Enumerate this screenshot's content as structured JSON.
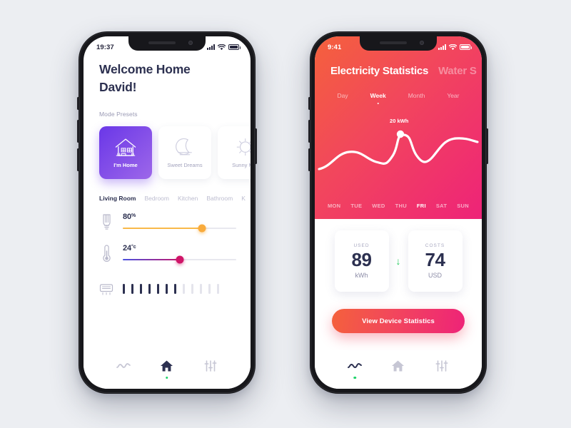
{
  "left_phone": {
    "status_bar": {
      "time": "19:37",
      "signal_icon": "signal-bars-icon",
      "wifi_icon": "wifi-icon",
      "battery_icon": "battery-icon"
    },
    "greeting_line1": "Welcome Home",
    "greeting_line2": "David!",
    "section_label": "Mode Presets",
    "presets": [
      {
        "label": "I'm Home",
        "icon": "house-icon",
        "active": true
      },
      {
        "label": "Sweet Dreams",
        "icon": "moon-icon",
        "active": false
      },
      {
        "label": "Sunny Mo",
        "icon": "sun-icon",
        "active": false
      }
    ],
    "rooms": [
      {
        "label": "Living Room",
        "active": true
      },
      {
        "label": "Bedroom",
        "active": false
      },
      {
        "label": "Kitchen",
        "active": false
      },
      {
        "label": "Bathroom",
        "active": false
      },
      {
        "label": "K",
        "active": false
      }
    ],
    "controls": {
      "light": {
        "icon": "lightbulb-icon",
        "value": "80",
        "unit": "%",
        "percent": 70,
        "fill_color": "#f9b949",
        "knob_color": "#f9ab3c"
      },
      "temperature": {
        "icon": "thermometer-icon",
        "value": "24",
        "unit": "°c",
        "percent": 50,
        "knob_color": "#cf1568"
      },
      "ac": {
        "icon": "air-conditioner-icon",
        "total_bars": 12,
        "active_bars": 7
      }
    },
    "nav": [
      {
        "icon": "stats-wave-icon",
        "active": false
      },
      {
        "icon": "home-icon",
        "active": true
      },
      {
        "icon": "sliders-icon",
        "active": false
      }
    ]
  },
  "right_phone": {
    "status_bar": {
      "time": "9:41",
      "signal_icon": "signal-bars-icon",
      "wifi_icon": "wifi-icon",
      "battery_icon": "battery-icon"
    },
    "title_active": "Electricity Statistics",
    "title_next": "Water S",
    "range_tabs": [
      {
        "label": "Day",
        "active": false
      },
      {
        "label": "Week",
        "active": true
      },
      {
        "label": "Month",
        "active": false
      },
      {
        "label": "Year",
        "active": false
      }
    ],
    "chart_point_label": "20 kWh",
    "stats": [
      {
        "caption": "USED",
        "value": "89",
        "unit": "kWh"
      },
      {
        "caption": "COSTS",
        "value": "74",
        "unit": "USD"
      }
    ],
    "trend_arrow": "↓",
    "cta_label": "View Device Statistics",
    "nav": [
      {
        "icon": "stats-wave-icon",
        "active": true
      },
      {
        "icon": "home-icon",
        "active": false
      },
      {
        "icon": "sliders-icon",
        "active": false
      }
    ],
    "gradient": {
      "from": "#f4613c",
      "mid": "#f2475c",
      "to": "#ee2378"
    }
  },
  "chart_data": {
    "type": "line",
    "title": "Electricity Statistics",
    "categories": [
      "MON",
      "TUE",
      "WED",
      "THU",
      "FRI",
      "SAT",
      "SUN"
    ],
    "values": [
      8,
      12.5,
      11,
      9.5,
      20,
      11.5,
      17
    ],
    "series": [
      {
        "name": "Electricity",
        "values": [
          8,
          12.5,
          11,
          9.5,
          20,
          11.5,
          17
        ]
      }
    ],
    "highlight": {
      "category": "FRI",
      "value": 20,
      "label": "20 kWh"
    },
    "ylabel": "kWh",
    "xlabel": "",
    "ylim": [
      0,
      24
    ],
    "grid": false,
    "legend": "none",
    "line_color": "#ffffff"
  }
}
